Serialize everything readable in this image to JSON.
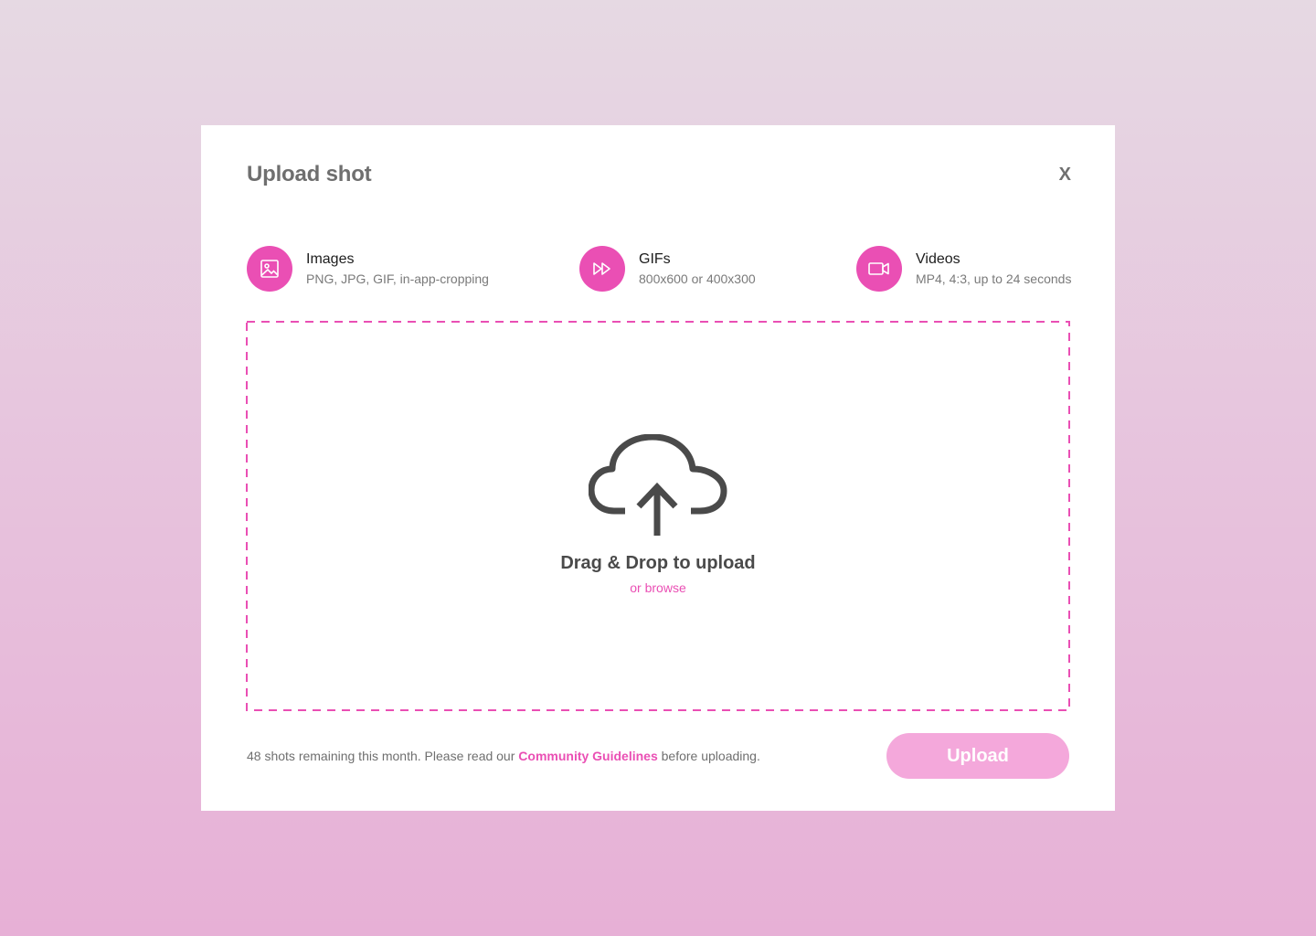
{
  "modal": {
    "title": "Upload shot",
    "close_label": "X"
  },
  "types": [
    {
      "label": "Images",
      "description": "PNG, JPG, GIF, in-app-cropping",
      "icon": "image-icon"
    },
    {
      "label": "GIFs",
      "description": "800x600 or 400x300",
      "icon": "fast-forward-icon"
    },
    {
      "label": "Videos",
      "description": "MP4, 4:3, up to 24 seconds",
      "icon": "video-camera-icon"
    }
  ],
  "dropzone": {
    "title": "Drag & Drop to upload",
    "browse_label": "or browse",
    "icon": "cloud-upload-icon"
  },
  "footer": {
    "text_before": "48 shots remaining this month. Please read our ",
    "link_label": "Community Guidelines",
    "text_after": " before uploading.",
    "upload_label": "Upload"
  },
  "colors": {
    "accent": "#ea4fb4",
    "button_disabled": "#f4a8db",
    "text_muted": "#6f6f6f"
  }
}
